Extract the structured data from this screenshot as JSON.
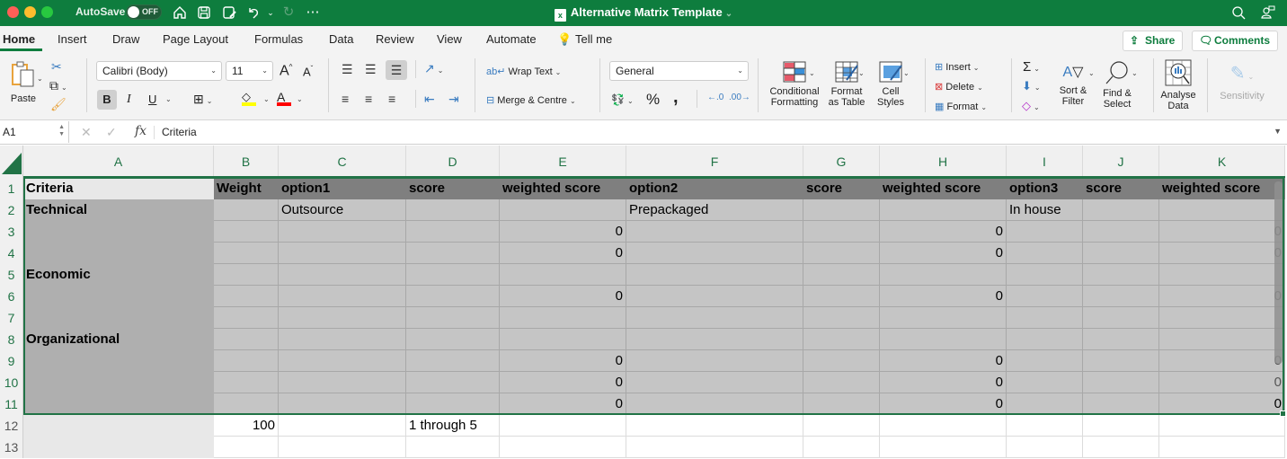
{
  "titlebar": {
    "autosave_label": "AutoSave",
    "autosave_state": "OFF",
    "document_title": "Alternative Matrix Template",
    "icons": [
      "home-icon",
      "save-icon",
      "save-as-icon",
      "undo-icon",
      "redo-icon",
      "more-icon",
      "search-icon",
      "account-icon"
    ]
  },
  "tabs": [
    {
      "label": "Home",
      "active": true
    },
    {
      "label": "Insert"
    },
    {
      "label": "Draw"
    },
    {
      "label": "Page Layout"
    },
    {
      "label": "Formulas"
    },
    {
      "label": "Data"
    },
    {
      "label": "Review"
    },
    {
      "label": "View"
    },
    {
      "label": "Automate"
    },
    {
      "label": "Tell me"
    }
  ],
  "header_buttons": {
    "share": "Share",
    "comments": "Comments"
  },
  "ribbon": {
    "paste": "Paste",
    "font_name": "Calibri (Body)",
    "font_size": "11",
    "bold": "B",
    "italic": "I",
    "underline": "U",
    "wrap_text": "Wrap Text",
    "merge_centre": "Merge & Centre",
    "number_format": "General",
    "percent": "%",
    "comma": ",",
    "conditional_formatting": [
      "Conditional",
      "Formatting"
    ],
    "format_as_table": [
      "Format",
      "as Table"
    ],
    "cell_styles": [
      "Cell",
      "Styles"
    ],
    "insert": "Insert",
    "delete": "Delete",
    "format": "Format",
    "sort_filter": [
      "Sort &",
      "Filter"
    ],
    "find_select": [
      "Find &",
      "Select"
    ],
    "analyse_data": [
      "Analyse",
      "Data"
    ],
    "sensitivity": "Sensitivity",
    "colors": {
      "highlight": "#ffff00",
      "font_color": "#ff0000"
    }
  },
  "formula_bar": {
    "name_box": "A1",
    "formula": "Criteria"
  },
  "sheet": {
    "columns": [
      "A",
      "B",
      "C",
      "D",
      "E",
      "F",
      "G",
      "H",
      "I",
      "J",
      "K"
    ],
    "rows": [
      "1",
      "2",
      "3",
      "4",
      "5",
      "6",
      "7",
      "8",
      "9",
      "10",
      "11",
      "12",
      "13"
    ],
    "selection": "A1:K11",
    "cells": {
      "A1": "Criteria",
      "B1": "Weight",
      "C1": "option1",
      "D1": "score",
      "E1": "weighted score",
      "F1": "option2",
      "G1": "score",
      "H1": "weighted score",
      "I1": "option3",
      "J1": "score",
      "K1": "weighted score",
      "A2": "Technical",
      "C2": "Outsource",
      "F2": "Prepackaged",
      "I2": "In house",
      "E3": "0",
      "H3": "0",
      "K3": "0",
      "E4": "0",
      "H4": "0",
      "K4": "0",
      "A5": "Economic",
      "E6": "0",
      "H6": "0",
      "K6": "0",
      "A8": "Organizational",
      "E9": "0",
      "H9": "0",
      "K9": "0",
      "E10": "0",
      "H10": "0",
      "K10": "0",
      "E11": "0",
      "H11": "0",
      "K11": "0",
      "B12": "100",
      "D12": "1 through 5"
    }
  }
}
